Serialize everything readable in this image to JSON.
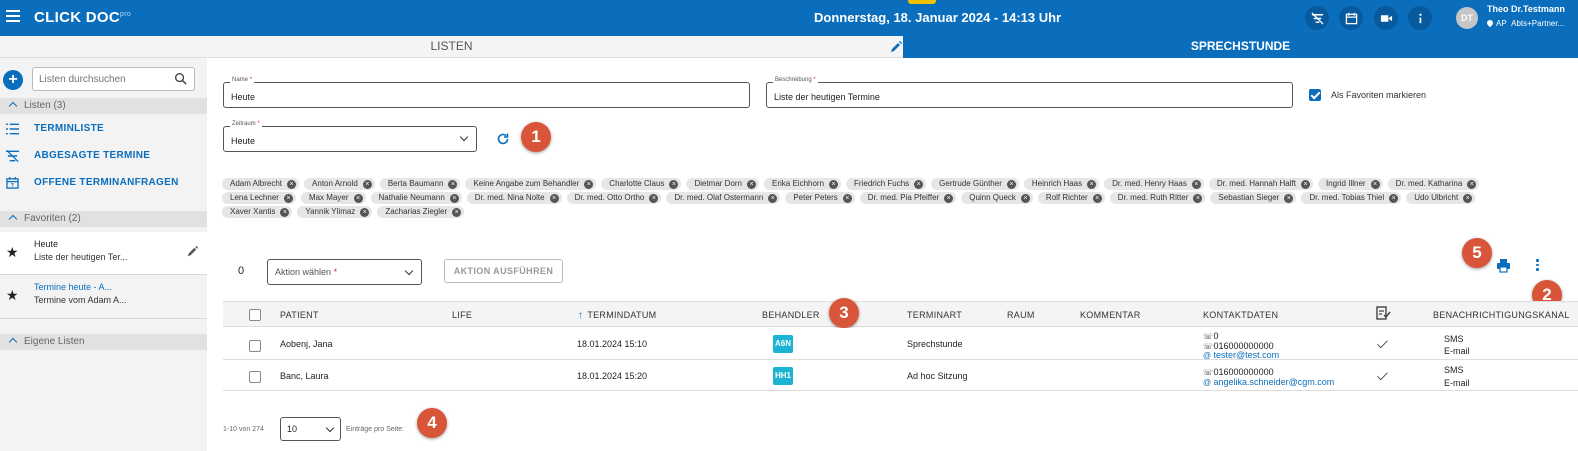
{
  "app": {
    "logo": "CLICK DOC",
    "logo_sup": "pro",
    "datetime": "Donnerstag, 18. Januar 2024 - 14:13 Uhr",
    "user_initials": "DT",
    "user_name": "Theo Dr.Testmann",
    "user_location": "AP",
    "user_org": "Abts+Partner...",
    "brand_color": "#0a6ebd",
    "annotation_color": "#d9553a"
  },
  "tabs": {
    "left": "LISTEN",
    "right": "SPRECHSTUNDE"
  },
  "sidebar": {
    "search_placeholder": "Listen durchsuchen",
    "sections": {
      "listen": "Listen (3)",
      "favoriten": "Favoriten (2)",
      "eigene": "Eigene Listen"
    },
    "lists": [
      {
        "label": "TERMINLISTE",
        "icon": "list-icon"
      },
      {
        "label": "ABGESAGTE TERMINE",
        "icon": "cancelled-list-icon"
      },
      {
        "label": "OFFENE TERMINANFRAGEN",
        "icon": "calendar-icon"
      }
    ],
    "favorites": [
      {
        "title": "Heute",
        "subtitle": "Liste der heutigen Ter..."
      },
      {
        "title": "Termine heute - A...",
        "subtitle": "Termine vom Adam A..."
      }
    ]
  },
  "form": {
    "name_label": "Name",
    "name_value": "Heute",
    "desc_label": "Beschreibung",
    "desc_value": "Liste der heutigen Termine",
    "fav_label": "Als Favoriten markieren",
    "fav_checked": true,
    "zeitraum_label": "Zeitraum",
    "zeitraum_value": "Heute",
    "required_mark": "*"
  },
  "chips": {
    "row1": [
      "Adam Albrecht",
      "Anton Arnold",
      "Berta Baumann",
      "Keine Angabe zum Behandler",
      "Charlotte Claus",
      "Dietmar Dorn",
      "Erika Eichhorn",
      "Friedrich Fuchs",
      "Gertrude Günther",
      "Heinrich Haas",
      "Dr. med. Henry Haas",
      "Dr. med. Hannah Halft",
      "Ingrid Illner",
      "Dr. med. Katharina"
    ],
    "row2": [
      "Lena Lechner",
      "Max Mayer",
      "Nathalie Neumann",
      "Dr. med. Nina Nolte",
      "Dr. med. Otto Ortho",
      "Dr. med. Olaf Ostermann",
      "Peter Peters",
      "Dr. med. Pia Pfeiffer",
      "Quinn Queck",
      "Rolf Richter",
      "Dr. med. Ruth Ritter",
      "Sebastian Sieger",
      "Dr. med. Tobias Thiel",
      "Udo Ulbricht"
    ],
    "row3": [
      "Xaver Xantis",
      "Yannik Ylimaz",
      "Zacharias Ziegler"
    ]
  },
  "actions": {
    "count": "0",
    "select_placeholder": "Aktion wählen",
    "execute_label": "AKTION AUSFÜHREN"
  },
  "table": {
    "columns": {
      "patient": "PATIENT",
      "life": "LIFE",
      "termindatum": "TERMINDATUM",
      "behandler": "BEHANDLER",
      "terminart": "TERMINART",
      "raum": "RAUM",
      "kommentar": "KOMMENTAR",
      "kontaktdaten": "KONTAKTDATEN",
      "benachrichtigung": "BENACHRICHTIGUNGSKANAL"
    },
    "rows": [
      {
        "patient": "Aobenj, Jana",
        "termindatum": "18.01.2024 15:10",
        "behandler": "A6N",
        "terminart": "Sprechstunde",
        "phone1": "0",
        "phone2": "016000000000",
        "email": "tester@test.com",
        "channel1": "SMS",
        "channel2": "E-mail"
      },
      {
        "patient": "Banc, Laura",
        "termindatum": "18.01.2024 15:20",
        "behandler": "HH1",
        "terminart": "Ad hoc Sitzung",
        "phone1": "016000000000",
        "email": "angelika.schneider@cgm.com",
        "channel1": "SMS",
        "channel2": "E-mail"
      }
    ]
  },
  "pagination": {
    "range": "1-10 von 274",
    "per_page": "10",
    "label": "Einträge pro Seite:"
  },
  "annotations": [
    "1",
    "2",
    "3",
    "4",
    "5"
  ]
}
